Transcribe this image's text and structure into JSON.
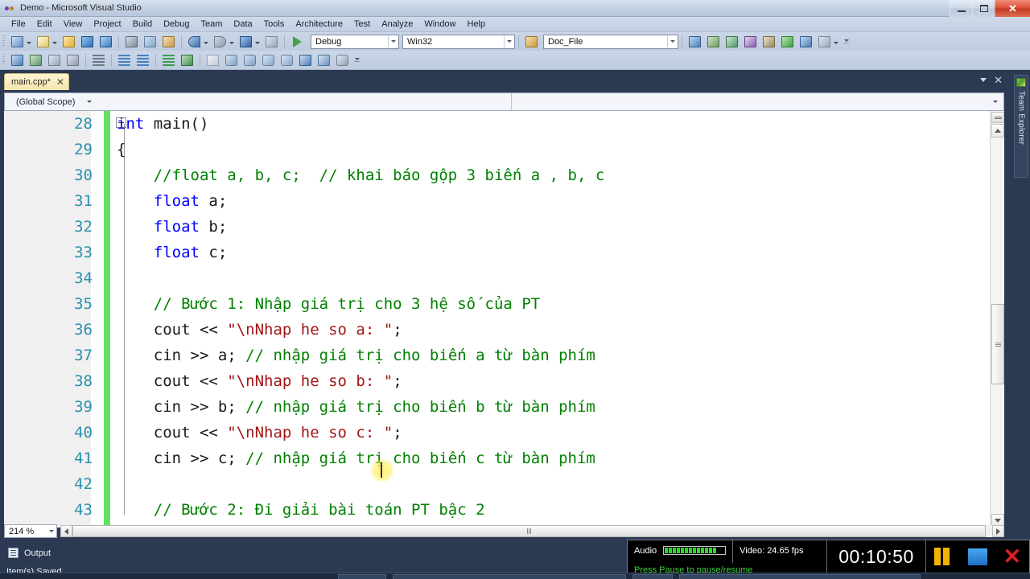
{
  "window": {
    "title": "Demo - Microsoft Visual Studio",
    "logo_icon": "visual-studio-logo-icon",
    "minimize_label": "Minimize",
    "restore_label": "Restore",
    "close_label": "✕"
  },
  "menubar": {
    "items": [
      {
        "label": "File"
      },
      {
        "label": "Edit"
      },
      {
        "label": "View"
      },
      {
        "label": "Project"
      },
      {
        "label": "Build"
      },
      {
        "label": "Debug"
      },
      {
        "label": "Team"
      },
      {
        "label": "Data"
      },
      {
        "label": "Tools"
      },
      {
        "label": "Architecture"
      },
      {
        "label": "Test"
      },
      {
        "label": "Analyze"
      },
      {
        "label": "Window"
      },
      {
        "label": "Help"
      }
    ]
  },
  "toolbar": {
    "config_combo": {
      "value": "Debug"
    },
    "platform_combo": {
      "value": "Win32"
    },
    "symbol_combo": {
      "value": "Doc_File"
    },
    "row1_icons": [
      "new-project-icon",
      "add-new-item-icon",
      "open-file-icon",
      "save-icon",
      "save-all-icon",
      "cut-icon",
      "copy-icon",
      "paste-icon",
      "undo-icon",
      "redo-icon",
      "navigate-backward-icon",
      "navigate-forward-icon",
      "start-debugging-icon"
    ],
    "row2_icons": [
      "window-icon",
      "toggle-icon",
      "pointer-icon",
      "font-size-icon",
      "list-icon",
      "decrease-indent-icon",
      "increase-indent-icon",
      "comment-icon",
      "uncomment-icon",
      "toggle-bookmark-icon",
      "prev-bookmark-icon",
      "next-bookmark-icon",
      "clear-bookmarks-icon",
      "bookmark-folder-icon",
      "find-symbol-icon",
      "find-results-icon",
      "toolbox-icon"
    ],
    "row1_right_icons": [
      "solution-explorer-icon",
      "properties-window-icon",
      "object-browser-icon",
      "toolbox-window-icon",
      "error-list-icon",
      "output-window-icon",
      "command-window-icon",
      "immediate-window-icon"
    ],
    "overflow_label": "Toolbar Options"
  },
  "tabstrip": {
    "tabs": [
      {
        "label": "main.cpp*",
        "close": "✕",
        "active": true
      }
    ],
    "dropdown_icon": "tab-list-chevron-icon",
    "close_icon": "✕"
  },
  "navbar": {
    "scope": "(Global Scope)",
    "member": ""
  },
  "editor": {
    "zoom_level": "214 %",
    "first_line": 28,
    "lines": [
      {
        "num": "28",
        "segments": [
          {
            "t": "int",
            "c": "kw"
          },
          {
            "t": " main()",
            "c": "pl"
          }
        ],
        "fold": true,
        "indent": 0
      },
      {
        "num": "29",
        "segments": [
          {
            "t": "{",
            "c": "pl"
          }
        ],
        "indent": 0
      },
      {
        "num": "30",
        "segments": [
          {
            "t": "    //float a, b, c;  // khai báo gộp 3 biến a , b, c",
            "c": "cm"
          }
        ],
        "indent": 1
      },
      {
        "num": "31",
        "segments": [
          {
            "t": "    ",
            "c": "pl"
          },
          {
            "t": "float",
            "c": "kw"
          },
          {
            "t": " a;",
            "c": "pl"
          }
        ],
        "indent": 1
      },
      {
        "num": "32",
        "segments": [
          {
            "t": "    ",
            "c": "pl"
          },
          {
            "t": "float",
            "c": "kw"
          },
          {
            "t": " b;",
            "c": "pl"
          }
        ],
        "indent": 1
      },
      {
        "num": "33",
        "segments": [
          {
            "t": "    ",
            "c": "pl"
          },
          {
            "t": "float",
            "c": "kw"
          },
          {
            "t": " c;",
            "c": "pl"
          }
        ],
        "indent": 1
      },
      {
        "num": "34",
        "segments": [],
        "indent": 1
      },
      {
        "num": "35",
        "segments": [
          {
            "t": "    // Bước 1: Nhập giá trị cho 3 hệ số của PT",
            "c": "cm"
          }
        ],
        "indent": 1
      },
      {
        "num": "36",
        "segments": [
          {
            "t": "    cout << ",
            "c": "pl"
          },
          {
            "t": "\"\\nNhap he so a: \"",
            "c": "str"
          },
          {
            "t": ";",
            "c": "pl"
          }
        ],
        "indent": 1
      },
      {
        "num": "37",
        "segments": [
          {
            "t": "    cin >> a; ",
            "c": "pl"
          },
          {
            "t": "// nhập giá trị cho biến a từ bàn phím",
            "c": "cm"
          }
        ],
        "indent": 1
      },
      {
        "num": "38",
        "segments": [
          {
            "t": "    cout << ",
            "c": "pl"
          },
          {
            "t": "\"\\nNhap he so b: \"",
            "c": "str"
          },
          {
            "t": ";",
            "c": "pl"
          }
        ],
        "indent": 1
      },
      {
        "num": "39",
        "segments": [
          {
            "t": "    cin >> b; ",
            "c": "pl"
          },
          {
            "t": "// nhập giá trị cho biến b từ bàn phím",
            "c": "cm"
          }
        ],
        "indent": 1
      },
      {
        "num": "40",
        "segments": [
          {
            "t": "    cout << ",
            "c": "pl"
          },
          {
            "t": "\"\\nNhap he so c: \"",
            "c": "str"
          },
          {
            "t": ";",
            "c": "pl"
          }
        ],
        "indent": 1
      },
      {
        "num": "41",
        "segments": [
          {
            "t": "    cin >> c; ",
            "c": "pl"
          },
          {
            "t": "// nhập giá trị cho biến c từ bàn phím",
            "c": "cm"
          }
        ],
        "indent": 1
      },
      {
        "num": "42",
        "segments": [],
        "indent": 1
      },
      {
        "num": "43",
        "segments": [
          {
            "t": "    // Bước 2: Đi giải bài toán PT bậc 2",
            "c": "cm"
          }
        ],
        "indent": 1
      }
    ],
    "colors": {
      "keyword": "#0000ff",
      "comment": "#008000",
      "string": "#a31515",
      "plain": "#1a1a1a",
      "line_number": "#2b91af",
      "change_margin": "#62e062",
      "background": "#ffffff"
    }
  },
  "rightdock": {
    "team_explorer_label": "Team Explorer",
    "team_explorer_icon": "team-explorer-icon"
  },
  "output_panel": {
    "label": "Output",
    "icon": "output-window-icon"
  },
  "statusbar": {
    "text": "Item(s) Saved"
  },
  "recorder": {
    "audio_label": "Audio",
    "video_label": "Video: 24.65 fps",
    "hint": "Press Pause to pause/resume",
    "timer": "00:10:50",
    "pause_icon": "pause-icon",
    "stop_icon": "stop-icon",
    "close_icon": "✕",
    "meter_segments": 13,
    "colors": {
      "hint": "#3ad03a",
      "meter": "#24e024",
      "pause": "#f0b400",
      "stop": "#2b84d6",
      "close": "#e02020"
    }
  }
}
